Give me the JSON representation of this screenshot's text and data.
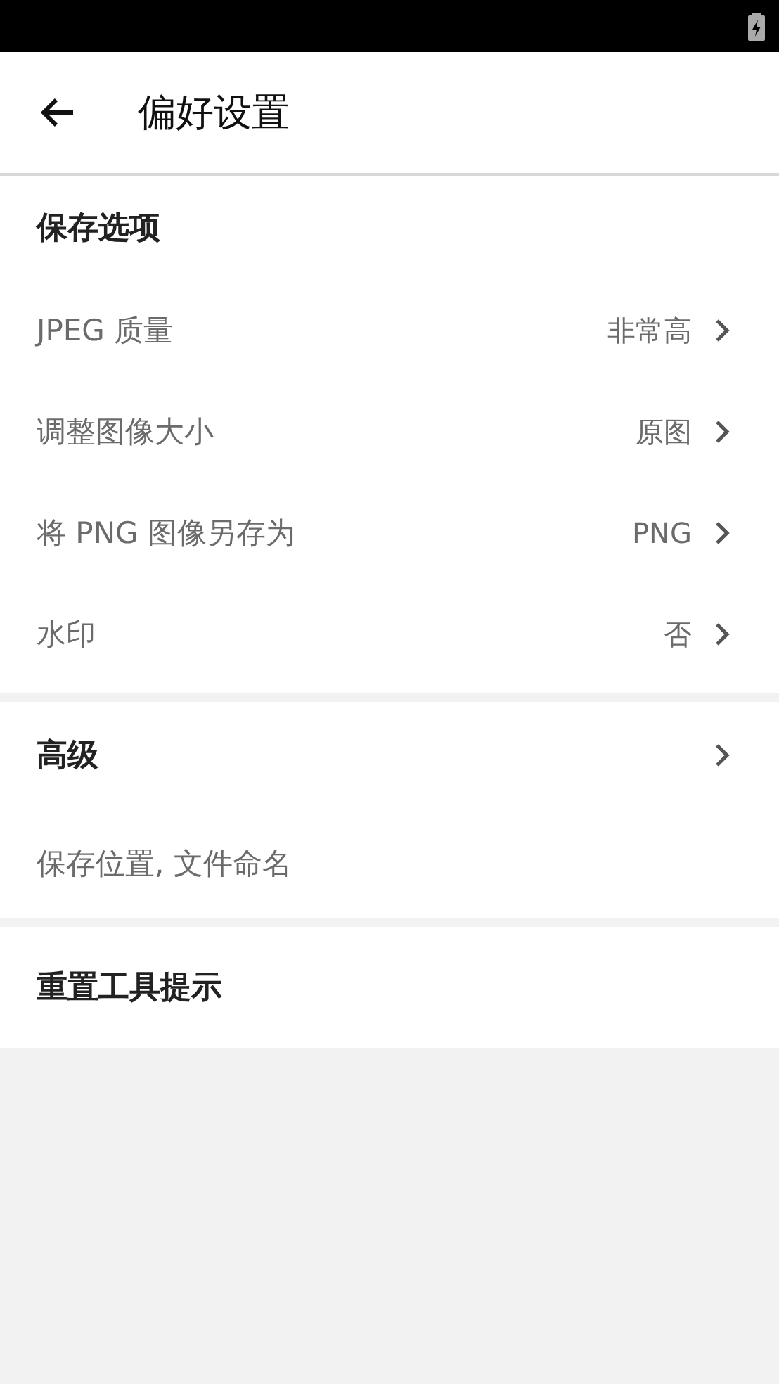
{
  "header": {
    "title": "偏好设置"
  },
  "sections": [
    {
      "kind": "group",
      "title": "保存选项",
      "rows": [
        {
          "label": "JPEG 质量",
          "value": "非常高"
        },
        {
          "label": "调整图像大小",
          "value": "原图"
        },
        {
          "label": "将 PNG 图像另存为",
          "value": "PNG"
        },
        {
          "label": "水印",
          "value": "否"
        }
      ]
    },
    {
      "kind": "link",
      "title": "高级",
      "subtitle": "保存位置, 文件命名"
    },
    {
      "kind": "action",
      "title": "重置工具提示"
    }
  ]
}
